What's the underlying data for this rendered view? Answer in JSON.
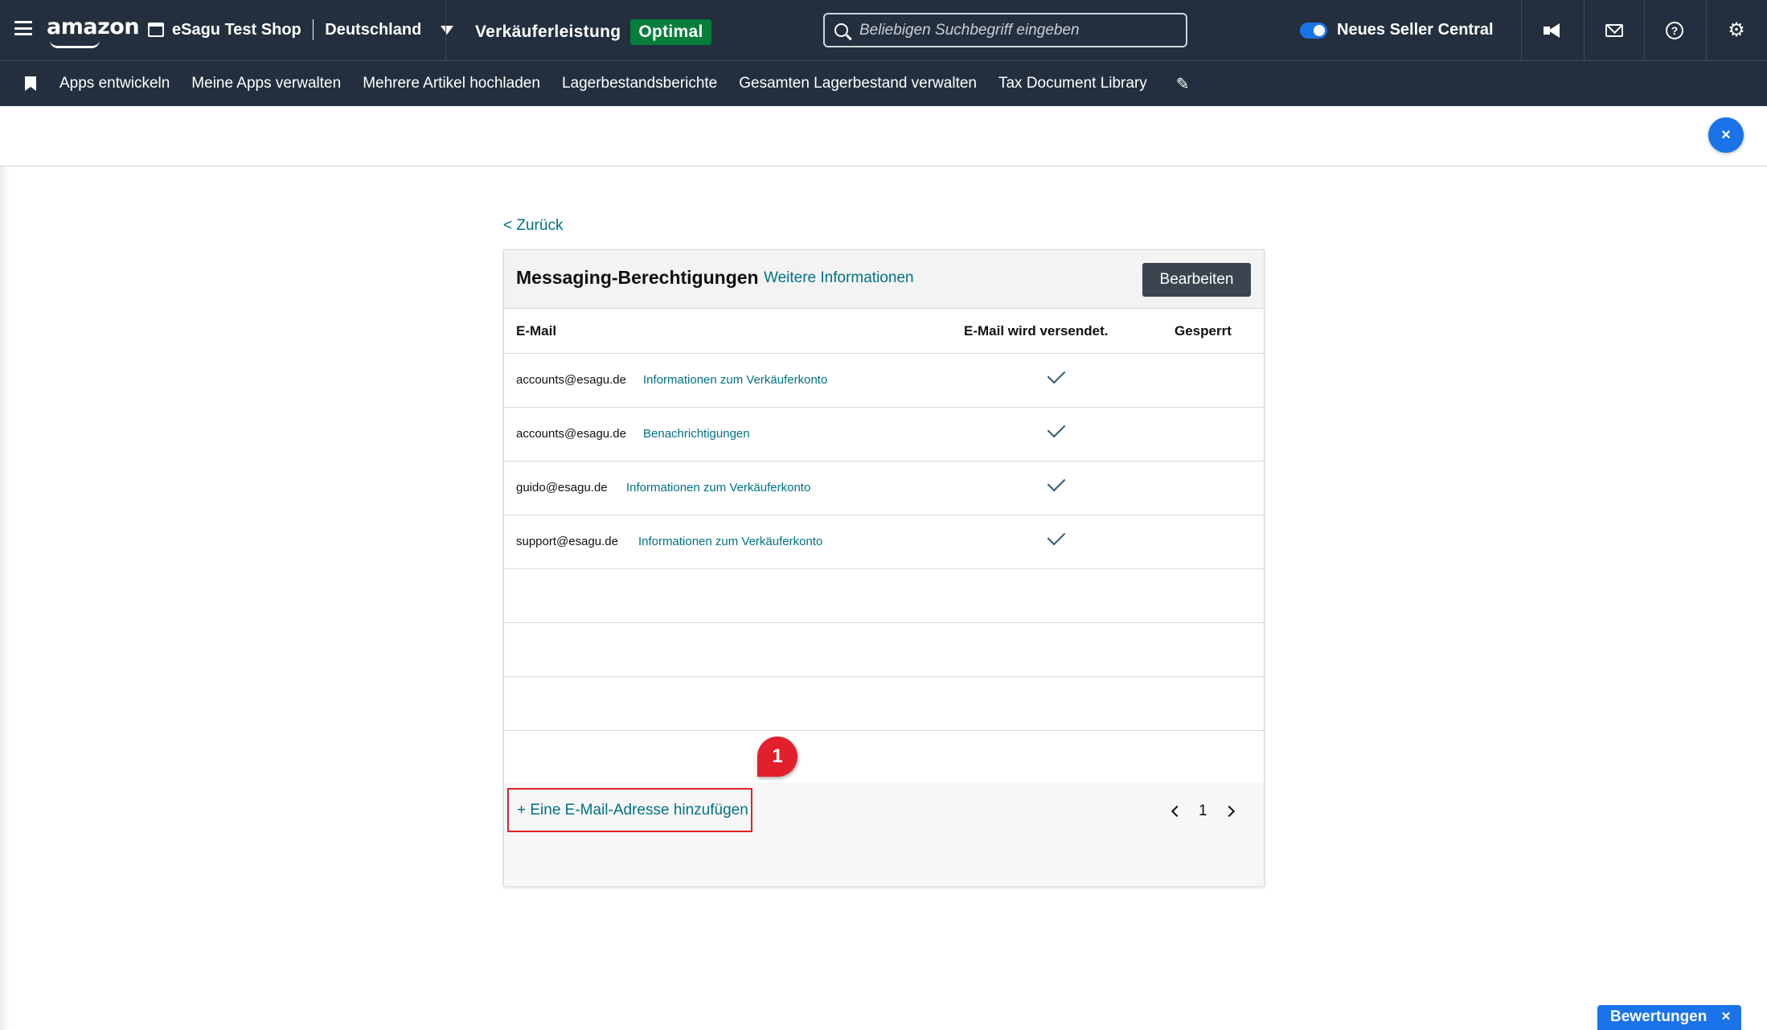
{
  "topbar": {
    "logo": "amazon",
    "store_name": "eSagu Test Shop",
    "marketplace": "Deutschland",
    "performance_label": "Verkäuferleistung",
    "performance_badge": "Optimal",
    "search_placeholder": "Beliebigen Suchbegriff eingeben",
    "toggle_label": "Neues Seller Central"
  },
  "nav": {
    "items": [
      {
        "label": "Apps entwickeln"
      },
      {
        "label": "Meine Apps verwalten"
      },
      {
        "label": "Mehrere Artikel hochladen"
      },
      {
        "label": "Lagerbestandsberichte"
      },
      {
        "label": "Gesamten Lagerbestand verwalten"
      },
      {
        "label": "Tax Document Library"
      }
    ]
  },
  "page": {
    "close_label": "×",
    "back_label": "< Zurück"
  },
  "card": {
    "title": "Messaging-Berechtigungen",
    "more_info": "Weitere Informationen",
    "edit_label": "Bearbeiten",
    "columns": [
      "E-Mail",
      "E-Mail wird versendet.",
      "Gesperrt"
    ],
    "rows": [
      {
        "email": "accounts@esagu.de",
        "topic": "Informationen zum Verkäuferkonto",
        "sent": true
      },
      {
        "email": "accounts@esagu.de",
        "topic": "Benachrichtigungen",
        "sent": true
      },
      {
        "email": "guido@esagu.de",
        "topic": "Informationen zum Verkäuferkonto",
        "sent": true
      },
      {
        "email": "support@esagu.de",
        "topic": "Informationen zum Verkäuferkonto",
        "sent": true
      }
    ],
    "add_email": "+ Eine E-Mail-Adresse hinzufügen",
    "page_number": "1"
  },
  "annotation": {
    "callout_number": "1",
    "accent_color": "#e1202b"
  },
  "feedback": {
    "label": "Bewertungen",
    "close": "×"
  }
}
